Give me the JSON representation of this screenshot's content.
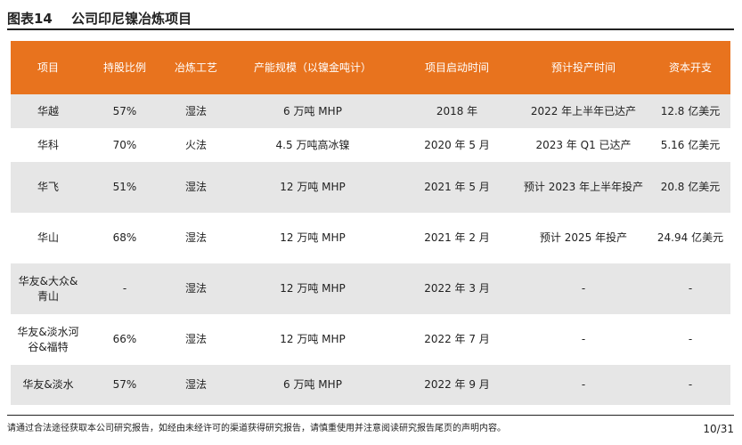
{
  "figure": {
    "number": "图表14",
    "title": "公司印尼镍冶炼项目"
  },
  "table": {
    "headers": [
      "项目",
      "持股比例",
      "冶炼工艺",
      "产能规模（以镍金吨计）",
      "项目启动时间",
      "预计投产时间",
      "资本开支"
    ],
    "rows": [
      [
        "华越",
        "57%",
        "湿法",
        "6 万吨 MHP",
        "2018 年",
        "2022 年上半年已达产",
        "12.8 亿美元"
      ],
      [
        "华科",
        "70%",
        "火法",
        "4.5 万吨高冰镍",
        "2020 年 5 月",
        "2023 年 Q1 已达产",
        "5.16 亿美元"
      ],
      [
        "华飞",
        "51%",
        "湿法",
        "12 万吨 MHP",
        "2021 年 5 月",
        "预计 2023 年上半年投产",
        "20.8 亿美元"
      ],
      [
        "华山",
        "68%",
        "湿法",
        "12 万吨 MHP",
        "2021 年 2 月",
        "预计 2025 年投产",
        "24.94 亿美元"
      ],
      [
        "华友&大众&青山",
        "-",
        "湿法",
        "12 万吨 MHP",
        "2022 年 3 月",
        "-",
        "-"
      ],
      [
        "华友&淡水河谷&福特",
        "66%",
        "湿法",
        "12 万吨 MHP",
        "2022 年 7 月",
        "-",
        "-"
      ],
      [
        "华友&淡水",
        "57%",
        "湿法",
        "6 万吨 MHP",
        "2022 年 9 月",
        "-",
        "-"
      ]
    ]
  },
  "footer": {
    "disclaimer": "请通过合法途径获取本公司研究报告，如经由未经许可的渠道获得研究报告，请慎重使用并注意阅读研究报告尾页的声明内容。",
    "page": "10/31"
  },
  "colors": {
    "header_bg": "#e8731e",
    "row_shade": "#e6e6e6"
  }
}
